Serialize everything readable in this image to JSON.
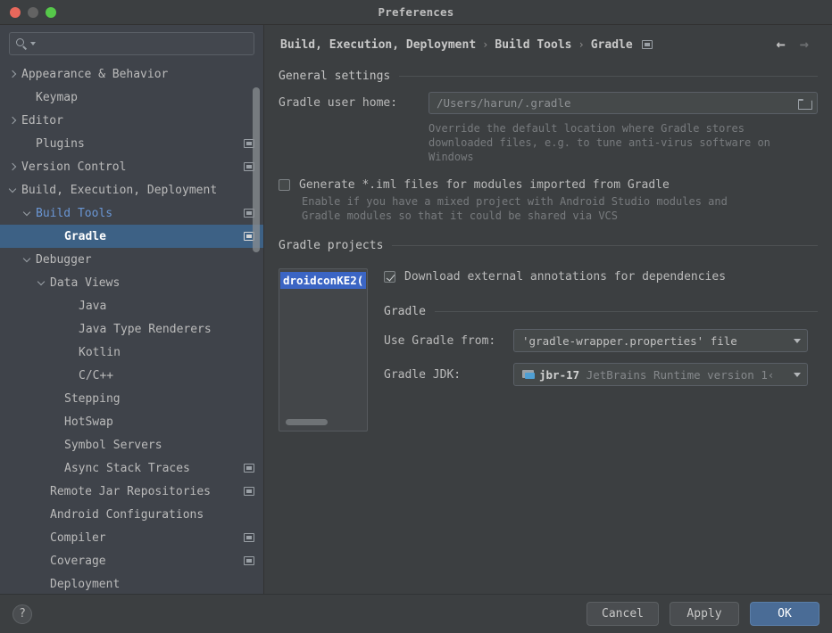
{
  "window": {
    "title": "Preferences",
    "traffic_lights": [
      "close-button",
      "minimize-button",
      "maximize-button"
    ]
  },
  "sidebar": {
    "search": {
      "value": "",
      "placeholder": ""
    },
    "items": [
      {
        "label": "Appearance & Behavior",
        "indent": 0,
        "arrow": "right",
        "mod": false,
        "selected": false,
        "accent": false
      },
      {
        "label": "Keymap",
        "indent": 1,
        "arrow": "none",
        "mod": false,
        "selected": false,
        "accent": false
      },
      {
        "label": "Editor",
        "indent": 0,
        "arrow": "right",
        "mod": false,
        "selected": false,
        "accent": false
      },
      {
        "label": "Plugins",
        "indent": 1,
        "arrow": "none",
        "mod": true,
        "selected": false,
        "accent": false
      },
      {
        "label": "Version Control",
        "indent": 0,
        "arrow": "right",
        "mod": true,
        "selected": false,
        "accent": false
      },
      {
        "label": "Build, Execution, Deployment",
        "indent": 0,
        "arrow": "down",
        "mod": false,
        "selected": false,
        "accent": false
      },
      {
        "label": "Build Tools",
        "indent": 1,
        "arrow": "down",
        "mod": true,
        "selected": false,
        "accent": true
      },
      {
        "label": "Gradle",
        "indent": 3,
        "arrow": "none",
        "mod": true,
        "selected": true,
        "accent": false
      },
      {
        "label": "Debugger",
        "indent": 1,
        "arrow": "down",
        "mod": false,
        "selected": false,
        "accent": false
      },
      {
        "label": "Data Views",
        "indent": 2,
        "arrow": "down",
        "mod": false,
        "selected": false,
        "accent": false
      },
      {
        "label": "Java",
        "indent": 4,
        "arrow": "none",
        "mod": false,
        "selected": false,
        "accent": false
      },
      {
        "label": "Java Type Renderers",
        "indent": 4,
        "arrow": "none",
        "mod": false,
        "selected": false,
        "accent": false
      },
      {
        "label": "Kotlin",
        "indent": 4,
        "arrow": "none",
        "mod": false,
        "selected": false,
        "accent": false
      },
      {
        "label": "C/C++",
        "indent": 4,
        "arrow": "none",
        "mod": false,
        "selected": false,
        "accent": false
      },
      {
        "label": "Stepping",
        "indent": 3,
        "arrow": "none",
        "mod": false,
        "selected": false,
        "accent": false
      },
      {
        "label": "HotSwap",
        "indent": 3,
        "arrow": "none",
        "mod": false,
        "selected": false,
        "accent": false
      },
      {
        "label": "Symbol Servers",
        "indent": 3,
        "arrow": "none",
        "mod": false,
        "selected": false,
        "accent": false
      },
      {
        "label": "Async Stack Traces",
        "indent": 3,
        "arrow": "none",
        "mod": true,
        "selected": false,
        "accent": false
      },
      {
        "label": "Remote Jar Repositories",
        "indent": 2,
        "arrow": "none",
        "mod": true,
        "selected": false,
        "accent": false
      },
      {
        "label": "Android Configurations",
        "indent": 2,
        "arrow": "none",
        "mod": false,
        "selected": false,
        "accent": false
      },
      {
        "label": "Compiler",
        "indent": 2,
        "arrow": "none",
        "mod": true,
        "selected": false,
        "accent": false
      },
      {
        "label": "Coverage",
        "indent": 2,
        "arrow": "none",
        "mod": true,
        "selected": false,
        "accent": false
      },
      {
        "label": "Deployment",
        "indent": 2,
        "arrow": "none",
        "mod": false,
        "selected": false,
        "accent": false
      }
    ]
  },
  "main": {
    "breadcrumb": {
      "parts": [
        "Build, Execution, Deployment",
        "Build Tools",
        "Gradle"
      ],
      "separator": "›"
    },
    "nav": {
      "back": "←",
      "forward": "→"
    },
    "general_settings": {
      "section_title": "General settings",
      "gradle_user_home_label": "Gradle user home:",
      "gradle_user_home_value": "/Users/harun/.gradle",
      "gradle_user_home_hint": "Override the default location where Gradle stores downloaded files, e.g. to tune anti-virus software on Windows",
      "generate_iml_label": "Generate *.iml files for modules imported from Gradle",
      "generate_iml_checked": false,
      "generate_iml_hint": "Enable if you have a mixed project with Android Studio modules and Gradle modules so that it could be shared via VCS"
    },
    "gradle_projects": {
      "section_title": "Gradle projects",
      "projects": [
        "droidconKE2("
      ],
      "selected_project": "droidconKE2(",
      "download_annotations_label": "Download external annotations for dependencies",
      "download_annotations_checked": true,
      "gradle_subsection_title": "Gradle",
      "use_gradle_from_label": "Use Gradle from:",
      "use_gradle_from_value": "'gradle-wrapper.properties' file",
      "gradle_jdk_label": "Gradle JDK:",
      "gradle_jdk_name": "jbr-17",
      "gradle_jdk_desc": "JetBrains Runtime version 1‹"
    }
  },
  "footer": {
    "help_label": "?",
    "cancel_label": "Cancel",
    "apply_label": "Apply",
    "ok_label": "OK"
  },
  "colors": {
    "window_bg": "#3c3f41",
    "sidebar_bg": "#3f434a",
    "selection_blue": "#3d6185",
    "list_selection_blue": "#3b65c4",
    "accent_text": "#6a96d4",
    "primary_button": "#4a6c96"
  }
}
